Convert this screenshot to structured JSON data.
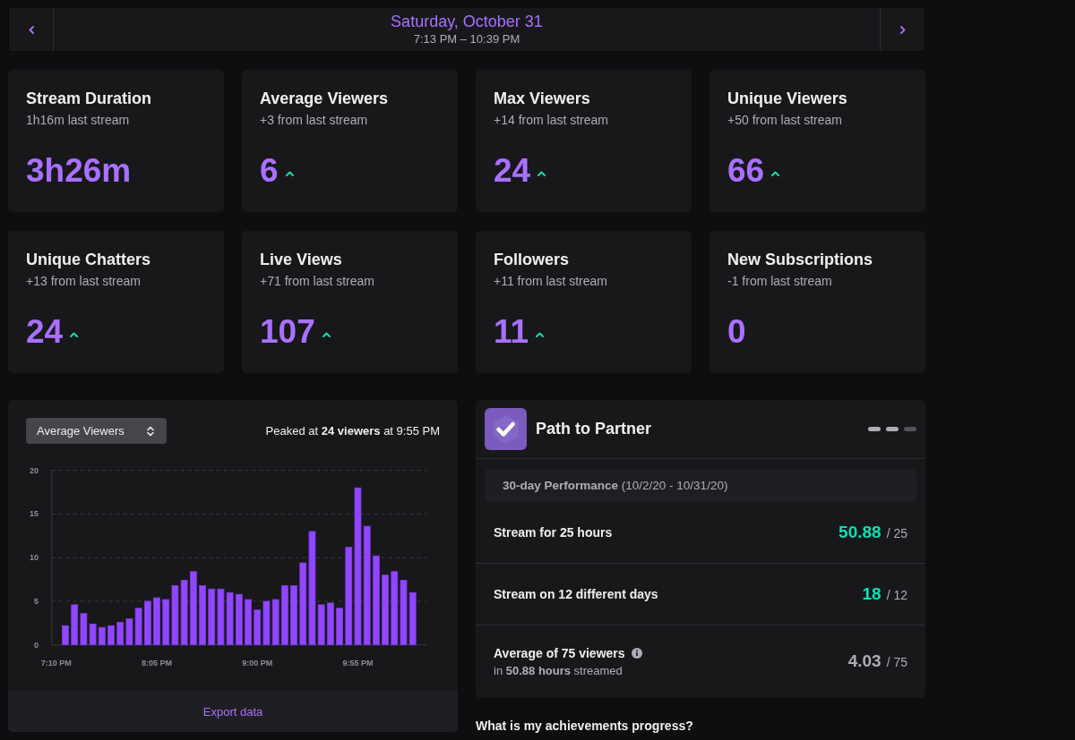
{
  "date_nav": {
    "title": "Saturday, October 31",
    "time_range": "7:13 PM – 10:39 PM"
  },
  "stat_cards": [
    {
      "title": "Stream Duration",
      "comparison": "1h16m last stream",
      "value": "3h26m",
      "trend_up": false
    },
    {
      "title": "Average Viewers",
      "comparison": "+3 from last stream",
      "value": "6",
      "trend_up": true
    },
    {
      "title": "Max Viewers",
      "comparison": "+14 from last stream",
      "value": "24",
      "trend_up": true
    },
    {
      "title": "Unique Viewers",
      "comparison": "+50 from last stream",
      "value": "66",
      "trend_up": true
    },
    {
      "title": "Unique Chatters",
      "comparison": "+13 from last stream",
      "value": "24",
      "trend_up": true
    },
    {
      "title": "Live Views",
      "comparison": "+71 from last stream",
      "value": "107",
      "trend_up": true
    },
    {
      "title": "Followers",
      "comparison": "+11 from last stream",
      "value": "11",
      "trend_up": true
    },
    {
      "title": "New Subscriptions",
      "comparison": "-1 from last stream",
      "value": "0",
      "trend_up": false
    }
  ],
  "chart_panel": {
    "metric_select": {
      "value": "Average Viewers"
    },
    "peak_note": "Peaked at **24 viewers** at 9:55 PM",
    "chart_data": {
      "type": "bar",
      "categories": [
        "7:10 PM",
        null,
        null,
        null,
        null,
        null,
        null,
        null,
        null,
        null,
        null,
        "8:05 PM",
        null,
        null,
        null,
        null,
        null,
        null,
        null,
        null,
        null,
        null,
        "9:00 PM",
        null,
        null,
        null,
        null,
        null,
        null,
        null,
        null,
        null,
        null,
        "9:55 PM",
        null,
        null,
        null,
        null,
        null,
        null
      ],
      "values": [
        null,
        2.2,
        4.6,
        3.6,
        2.4,
        2.0,
        2.2,
        2.6,
        3.0,
        4.2,
        5.0,
        5.4,
        5.2,
        6.8,
        7.4,
        8.4,
        6.8,
        6.4,
        6.4,
        6.0,
        5.8,
        5.2,
        4.0,
        5.0,
        5.2,
        6.8,
        6.8,
        9.4,
        13.0,
        4.6,
        4.8,
        4.2,
        11.2,
        18.0,
        13.6,
        10.2,
        8.0,
        8.4,
        7.4,
        6.0
      ],
      "ylim": [
        0,
        20
      ],
      "yticks": [
        0,
        5,
        10,
        15,
        20
      ],
      "grid": true
    },
    "export_link": "Export data"
  },
  "path_to_partner": {
    "title": "Path to Partner",
    "progress_steps": [
      {
        "complete": true
      },
      {
        "complete": true
      },
      {
        "complete": false
      }
    ],
    "period": "**30-day Performance** (10/2/20 - 10/31/20)",
    "goals": [
      {
        "label": "Stream for 25 hours",
        "info": false,
        "value": "50.88",
        "target": "/ 25",
        "met": true
      },
      {
        "label": "Stream on 12 different days",
        "info": false,
        "value": "18",
        "target": "/ 12",
        "met": true
      },
      {
        "label": "Average of 75 viewers",
        "info": true,
        "note": "in **50.88 hours** streamed",
        "value": "4.03",
        "target": "/ 75",
        "met": false
      }
    ]
  },
  "achievements_heading": "What is my achievements progress?"
}
